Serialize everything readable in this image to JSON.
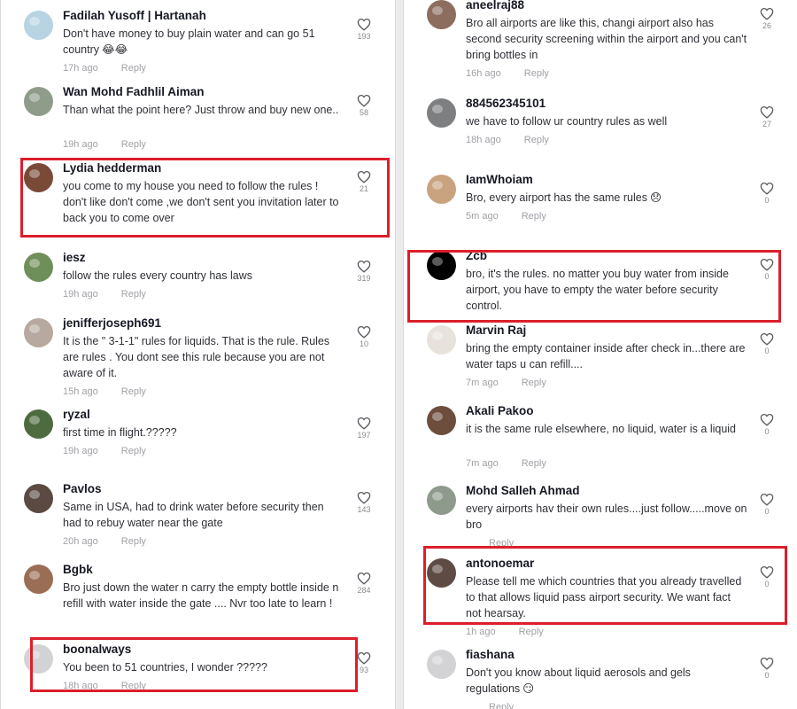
{
  "colors": {
    "accent_red": "#dc1f2b",
    "meta_gray": "#a0a1a6"
  },
  "icons": {
    "like": "heart-outline-icon",
    "avatar": "user-avatar-icon"
  },
  "left_comments": [
    {
      "user": "Fadilah Yusoff | Hartanah",
      "text": "Don't have money to buy plain water and can go 51 country",
      "emoji": "😂😂",
      "time": "17h ago",
      "reply": "Reply",
      "likes": "193",
      "avatar_color": "#b8d4e3"
    },
    {
      "user": "Wan Mohd Fadhlil Aiman",
      "text": "Than what the point here? Just throw and buy new one..",
      "time": "19h ago",
      "reply": "Reply",
      "likes": "58",
      "avatar_color": "#8f9c8a"
    },
    {
      "user": "Lydia hedderman",
      "text": "you come to my house you need to follow the rules ! don't like don't come ,we don't sent you invitation later to back you to come over",
      "time": "",
      "reply": "",
      "likes": "21",
      "avatar_color": "#7a4a38"
    },
    {
      "user": "iesz",
      "text": "follow the rules every country has laws",
      "time": "19h ago",
      "reply": "Reply",
      "likes": "319",
      "avatar_color": "#6f8f5a"
    },
    {
      "user": "jenifferjoseph691",
      "text": "It is the \" 3-1-1\" rules for liquids. That is the rule. Rules are rules . You dont see this rule because you are not aware of it.",
      "time": "15h ago",
      "reply": "Reply",
      "likes": "10",
      "avatar_color": "#b7a9a0"
    },
    {
      "user": "ryzal",
      "text": "first time in flight.?????",
      "time": "19h ago",
      "reply": "Reply",
      "likes": "197",
      "avatar_color": "#4d6b3e"
    },
    {
      "user": "Pavlos",
      "text": "Same in USA, had to drink water before security then had to rebuy water near the gate",
      "time": "20h ago",
      "reply": "Reply",
      "likes": "143",
      "avatar_color": "#5a4a42"
    },
    {
      "user": "Bgbk",
      "text": "Bro just down the water n carry the empty bottle inside n refill with water inside the gate .... Nvr too late to learn !",
      "time": "",
      "reply": "",
      "likes": "284",
      "avatar_color": "#9a6e55"
    },
    {
      "user": "boonalways",
      "text": "You been to 51 countries, I wonder ?????",
      "time": "18h ago",
      "reply": "Reply",
      "likes": "93",
      "avatar_color": "#d3d3d6"
    }
  ],
  "right_comments": [
    {
      "user": "aneelraj88",
      "text": "Bro all airports are like this, changi airport also has second security screening within the airport and you can't bring bottles in",
      "time": "16h ago",
      "reply": "Reply",
      "likes": "26",
      "avatar_color": "#8c6d5e"
    },
    {
      "user": "884562345101",
      "text": "we have to follow ur country rules as well",
      "time": "18h ago",
      "reply": "Reply",
      "likes": "27",
      "avatar_color": "#7d7f80"
    },
    {
      "user": "IamWhoiam",
      "text": "Bro, every airport has the same rules",
      "emoji": "😞",
      "time": "5m ago",
      "reply": "Reply",
      "likes": "0",
      "avatar_color": "#c9a27f"
    },
    {
      "user": "Zcb",
      "text": "bro, it's the rules. no matter you buy water from inside airport, you have to empty the water before security control.",
      "time": "",
      "reply": "",
      "likes": "0",
      "avatar_color": "#000000"
    },
    {
      "user": "Marvin Raj",
      "text": "bring the empty container inside after check in...there are water taps u can refill....",
      "time": "7m ago",
      "reply": "Reply",
      "likes": "0",
      "avatar_color": "#e7e3dc"
    },
    {
      "user": "Akali Pakoo",
      "text": "it is the same rule elsewhere, no liquid, water is a liquid",
      "time": "7m ago",
      "reply": "Reply",
      "likes": "0",
      "avatar_color": "#6d4e3c"
    },
    {
      "user": "Mohd Salleh Ahmad",
      "text": "every airports hav their own rules....just follow.....move on bro",
      "time": "",
      "reply": "Reply",
      "likes": "0",
      "avatar_color": "#8e9a8c"
    },
    {
      "user": "antonoemar",
      "text": "Please tell me which countries that you already travelled to that allows liquid pass airport security. We want fact not hearsay.",
      "time": "1h ago",
      "reply": "Reply",
      "likes": "0",
      "avatar_color": "#5e4b44"
    },
    {
      "user": "fiashana",
      "text": "Don't you know about liquid aerosols and gels regulations",
      "emoji": "😏",
      "time": "",
      "reply": "Reply",
      "likes": "0",
      "avatar_color": "#d3d3d6"
    }
  ]
}
